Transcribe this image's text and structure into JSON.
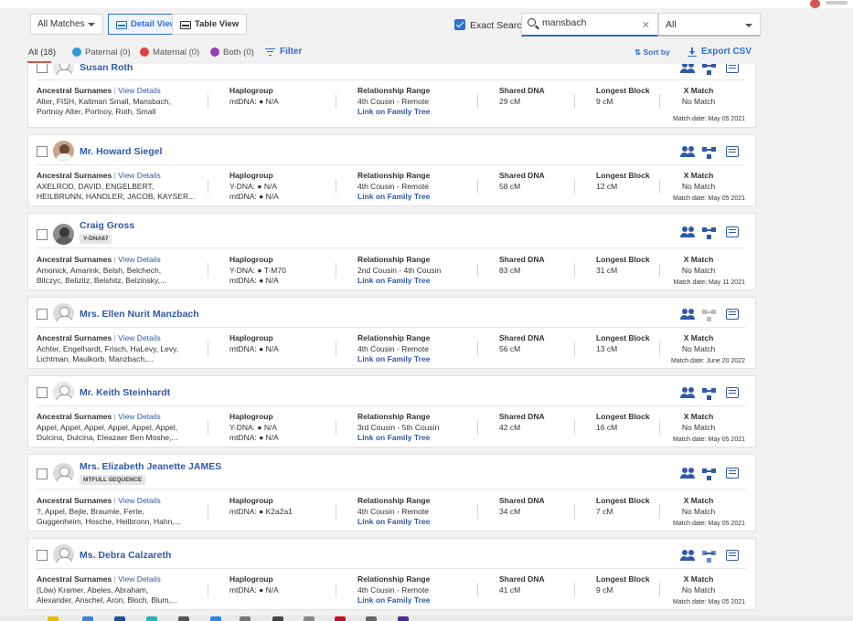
{
  "toolbar": {
    "matches_select": "All Matches",
    "detail_view": "Detail View",
    "table_view": "Table View",
    "exact_search_label": "Exact Search",
    "search_value": "mansbach",
    "search_scope": "All"
  },
  "filters": {
    "all": "All (18)",
    "paternal": "Paternal (0)",
    "maternal": "Maternal (0)",
    "both": "Both (0)",
    "filter": "Filter",
    "sort_by": "Sort by",
    "export_csv": "Export CSV"
  },
  "headers": {
    "surnames": "Ancestral Surnames",
    "view_details": "View Details",
    "haplogroup": "Haplogroup",
    "relationship": "Relationship Range",
    "shared_dna": "Shared DNA",
    "longest_block": "Longest Block",
    "x_match": "X Match",
    "link_tree": "Link on Family Tree"
  },
  "matches": [
    {
      "name": "Susan Roth",
      "badge": "",
      "surnames_line1": "Alter, FISH, Kaltman Small, Mansbach,",
      "surnames_line2": "Portnoy Alter, Portnoy, Roth, Small",
      "hap_line1": "mtDNA: ● N/A",
      "hap_line2": "",
      "relationship": "4th Cousin - Remote",
      "shared": "29 cM",
      "longest": "9 cM",
      "xmatch": "No Match",
      "date": "Match date: May 05 2021"
    },
    {
      "name": "Mr. Howard Siegel",
      "badge": "",
      "surnames_line1": "AXELROD, DAVID, ENGELBERT,",
      "surnames_line2": "HEILBRUNN, HANDLER, JACOB, KAYSER...",
      "hap_line1": "Y-DNA: ● N/A",
      "hap_line2": "mtDNA: ● N/A",
      "relationship": "4th Cousin - Remote",
      "shared": "58 cM",
      "longest": "12 cM",
      "xmatch": "No Match",
      "date": "Match date: May 05 2021"
    },
    {
      "name": "Craig Gross",
      "badge": "Y-DNA67",
      "surnames_line1": "Amonick, Amarink, Belsh, Belchech,",
      "surnames_line2": "Bilczyc, Belizitz, Belshitz, Belzinsky,...",
      "hap_line1": "Y-DNA: ● T-M70",
      "hap_line2": "mtDNA: ● N/A",
      "relationship": "2nd Cousin - 4th Cousin",
      "shared": "83 cM",
      "longest": "31 cM",
      "xmatch": "No Match",
      "date": "Match date: May 11 2021"
    },
    {
      "name": "Mrs. Ellen Nurit Manzbach",
      "badge": "",
      "surnames_line1": "Achter, Engelhardt, Frisch, HaLevy, Levy,",
      "surnames_line2": "Lichtman, Maulkorb, Manzbach,...",
      "hap_line1": "mtDNA: ● N/A",
      "hap_line2": "",
      "relationship": "4th Cousin - Remote",
      "shared": "56 cM",
      "longest": "13 cM",
      "xmatch": "No Match",
      "date": "Match date: June 20 2022"
    },
    {
      "name": "Mr. Keith Steinhardt",
      "badge": "",
      "surnames_line1": "Appel, Appel, Appel, Appel, Appel, Appel,",
      "surnames_line2": "Dulcina, Dulcina, Eleazaer Ben Moshe,...",
      "hap_line1": "Y-DNA: ● N/A",
      "hap_line2": "mtDNA: ● N/A",
      "relationship": "3rd Cousin - 5th Cousin",
      "shared": "42 cM",
      "longest": "16 cM",
      "xmatch": "No Match",
      "date": "Match date: May 05 2021"
    },
    {
      "name": "Mrs. Elizabeth Jeanette JAMES",
      "badge": "MTFULL SEQUENCE",
      "surnames_line1": "?, Appel, Bejle, Braumle, Ferte,",
      "surnames_line2": "Guggenheim, Hosche, Heilbronn, Hahn,...",
      "hap_line1": "mtDNA: ● K2a2a1",
      "hap_line2": "",
      "relationship": "4th Cousin - Remote",
      "shared": "34 cM",
      "longest": "7 cM",
      "xmatch": "No Match",
      "date": "Match date: May 05 2021"
    },
    {
      "name": "Ms. Debra Calzareth",
      "badge": "",
      "surnames_line1": "(Löw) Kramer, Abeles, Abraham,",
      "surnames_line2": "Alexander, Anschel, Aron, Bloch, Blum,...",
      "hap_line1": "mtDNA: ● N/A",
      "hap_line2": "",
      "relationship": "4th Cousin - Remote",
      "shared": "41 cM",
      "longest": "9 cM",
      "xmatch": "No Match",
      "date": "Match date: May 05 2021"
    }
  ]
}
